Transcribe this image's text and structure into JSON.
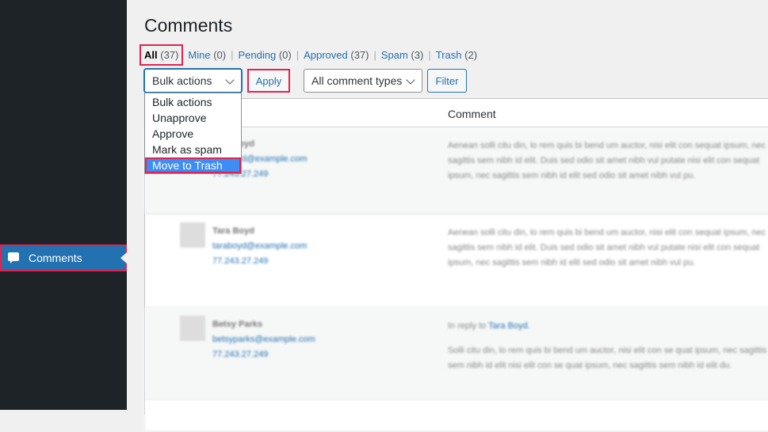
{
  "sidebar": {
    "active_item": {
      "label": "Comments",
      "icon": "comment-bubble-icon"
    }
  },
  "page": {
    "title": "Comments"
  },
  "filters": [
    {
      "label": "All",
      "count": "(37)",
      "current": true
    },
    {
      "label": "Mine",
      "count": "(0)"
    },
    {
      "label": "Pending",
      "count": "(0)"
    },
    {
      "label": "Approved",
      "count": "(37)"
    },
    {
      "label": "Spam",
      "count": "(3)"
    },
    {
      "label": "Trash",
      "count": "(2)"
    }
  ],
  "toolbar": {
    "bulk_selected": "Bulk actions",
    "apply_label": "Apply",
    "types_selected": "All comment types",
    "filter_label": "Filter"
  },
  "bulk_options": [
    "Bulk actions",
    "Unapprove",
    "Approve",
    "Mark as spam",
    "Move to Trash"
  ],
  "bulk_highlighted": "Move to Trash",
  "table": {
    "columns": {
      "comment": "Comment"
    },
    "rows": [
      {
        "checked": false,
        "author": "Tara Boyd",
        "email": "taraboyd@example.com",
        "ip": "77.243.27.249",
        "reply_prefix": "",
        "reply_to": "",
        "text": "Aenean solli citu din, lo rem quis bi bend um auctor, nisi elit con sequat ipsum, nec sagittis sem nibh id elit. Duis sed odio sit amet nibh vul putate nisi elit con sequat ipsum, nec sagittis sem nibh id elit sed odio sit amet nibh vul pu."
      },
      {
        "checked": true,
        "author": "Tara Boyd",
        "email": "taraboyd@example.com",
        "ip": "77.243.27.249",
        "reply_prefix": "",
        "reply_to": "",
        "text": "Aenean solli citu din, lo rem quis bi bend um auctor, nisi elit con sequat ipsum, nec sagittis sem nibh id elit. Duis sed odio sit amet nibh vul putate nisi elit con sequat ipsum, nec sagittis sem nibh id elit sed odio sit amet nibh vul pu."
      },
      {
        "checked": true,
        "author": "Betsy Parks",
        "email": "betsyparks@example.com",
        "ip": "77.243.27.249",
        "reply_prefix": "In reply to",
        "reply_to": "Tara Boyd.",
        "text": "Solli citu din, lo rem quis bi bend um auctor, nisi elit con se quat ipsum, nec sagittis sem nibh id elit nisi elit con se quat ipsum, nec sagittis sem nibh id elit du."
      }
    ]
  },
  "colors": {
    "accent": "#2271b1",
    "highlight": "#e0244f",
    "sidebar": "#1d2327"
  }
}
